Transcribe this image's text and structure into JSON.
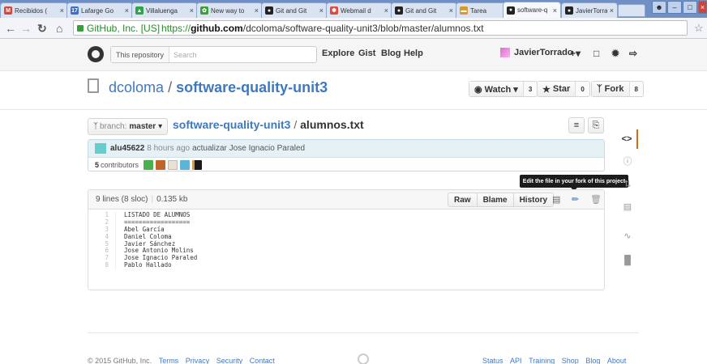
{
  "browser": {
    "tabs": [
      {
        "title": "Recibidos (",
        "favicon": "gmail-icon",
        "color": "#d44638",
        "glyph": "M"
      },
      {
        "title": "Lafarge Go",
        "favicon": "calendar-icon",
        "color": "#3a6fd0",
        "glyph": "17"
      },
      {
        "title": "Villaluenga",
        "favicon": "drive-icon",
        "color": "#2fa24a",
        "glyph": "▲"
      },
      {
        "title": "New way to",
        "favicon": "tree-icon",
        "color": "#37a035",
        "glyph": "✿"
      },
      {
        "title": "Git and Git",
        "favicon": "github-icon",
        "color": "#222222",
        "glyph": "●"
      },
      {
        "title": "Webmail d",
        "favicon": "flower-icon",
        "color": "#e0473c",
        "glyph": "✽"
      },
      {
        "title": "Git and Git",
        "favicon": "github-icon",
        "color": "#222222",
        "glyph": "●"
      },
      {
        "title": "Tarea",
        "favicon": "folder-icon",
        "color": "#d89a2a",
        "glyph": "▬"
      },
      {
        "title": "software-q",
        "favicon": "github-icon",
        "color": "#222222",
        "glyph": "●",
        "active": true
      },
      {
        "title": "JavierTorra",
        "favicon": "github-icon",
        "color": "#222222",
        "glyph": "●"
      }
    ],
    "site_name": "GitHub, Inc. [US]",
    "url_secure": "https://",
    "url_host": "github.com",
    "url_path": "/dcoloma/software-quality-unit3/blob/master/alumnos.txt"
  },
  "header": {
    "search_scope": "This repository",
    "search_placeholder": "Search",
    "nav": [
      "Explore",
      "Gist",
      "Blog",
      "Help"
    ],
    "username": "JavierTorrado",
    "plus": "+▾"
  },
  "repo": {
    "owner": "dcoloma",
    "separator": "/",
    "name": "software-quality-unit3",
    "watch_label": "Watch ▾",
    "watch_count": "3",
    "star_label": "Star",
    "star_count": "0",
    "fork_label": "Fork",
    "fork_count": "8"
  },
  "filenav": {
    "branch_label": "branch:",
    "branch_name": "master",
    "caret": "▾",
    "repo_crumb": "software-quality-unit3",
    "sep": "/",
    "file_name": "alumnos.txt"
  },
  "commit": {
    "author": "alu45622",
    "time": "8 hours ago",
    "message": "actualizar Jose Ignacio Paraled",
    "contributors_count": "5",
    "contributors_label": "contributors",
    "contributor_colors": [
      "#4bb04b",
      "#c0642a",
      "#e8e0d0",
      "#5ab5d8",
      "#1a1a1a"
    ]
  },
  "tooltip": "Edit the file in your fork of this project",
  "file": {
    "lines_info": "9 lines (8 sloc)",
    "size": "0.135 kb",
    "buttons": [
      "Raw",
      "Blame",
      "History"
    ],
    "lines": [
      "LISTADO DE ALUMNOS",
      "==================",
      "Abel García",
      "Daniel Coloma",
      "Javier Sánchez",
      "Jose Antonio Molins",
      "Jose Ignacio Paraled",
      "Pablo Hallado"
    ]
  },
  "footer": {
    "copyright": "© 2015 GitHub, Inc.",
    "left_links": [
      "Terms",
      "Privacy",
      "Security",
      "Contact"
    ],
    "right_links": [
      "Status",
      "API",
      "Training",
      "Shop",
      "Blog",
      "About"
    ]
  }
}
